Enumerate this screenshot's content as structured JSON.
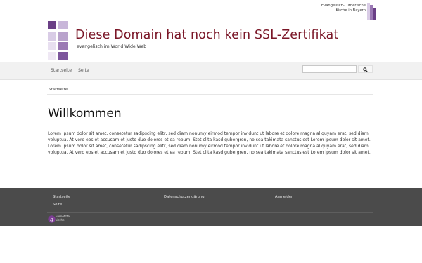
{
  "header": {
    "org_logo_text": "Evangelisch-Lutherische\nKirche in Bayern",
    "site_title": "Diese Domain hat noch kein SSL-Zertifikat",
    "tagline": "evangelisch im World Wide Web"
  },
  "nav": {
    "items": [
      {
        "label": "Startseite"
      },
      {
        "label": "Seite"
      }
    ],
    "search": {
      "value": "",
      "placeholder": ""
    }
  },
  "breadcrumb": {
    "label": "Startseite"
  },
  "main": {
    "heading": "Willkommen",
    "body": "Lorem ipsum dolor sit amet, consetetur sadipscing elitr, sed diam nonumy eirmod tempor invidunt ut labore et dolore magna aliquyam erat, sed diam voluptua. At vero eos et accusam et justo duo dolores et ea rebum. Stet clita kasd gubergren, no sea takimata sanctus est Lorem ipsum dolor sit amet. Lorem ipsum dolor sit amet, consetetur sadipscing elitr, sed diam nonumy eirmod tempor invidunt ut labore et dolore magna aliquyam erat, sed diam voluptua. At vero eos et accusam et justo duo dolores et ea rebum. Stet clita kasd gubergren, no sea takimata sanctus est Lorem ipsum dolor sit amet."
  },
  "footer": {
    "links": {
      "startseite": "Startseite",
      "seite": "Seite",
      "datenschutz": "Datenschutzerklärung",
      "anmelden": "Anmelden"
    },
    "vernetzte_logo_text": "vernetzte\nkirche"
  },
  "colors": {
    "title": "#7a1627",
    "purple_dark": "#6a3f86",
    "purple_mid": "#9b79b4",
    "purple_light": "#d9cce6",
    "nav_bg": "#f1f1f1",
    "footer_bg": "#4b4b4b"
  },
  "icons": {
    "search": "search-icon",
    "org_logo": "elkb-logo",
    "site_logo": "site-logo-mosaic",
    "footer_logo": "vernetzte-kirche-logo"
  }
}
